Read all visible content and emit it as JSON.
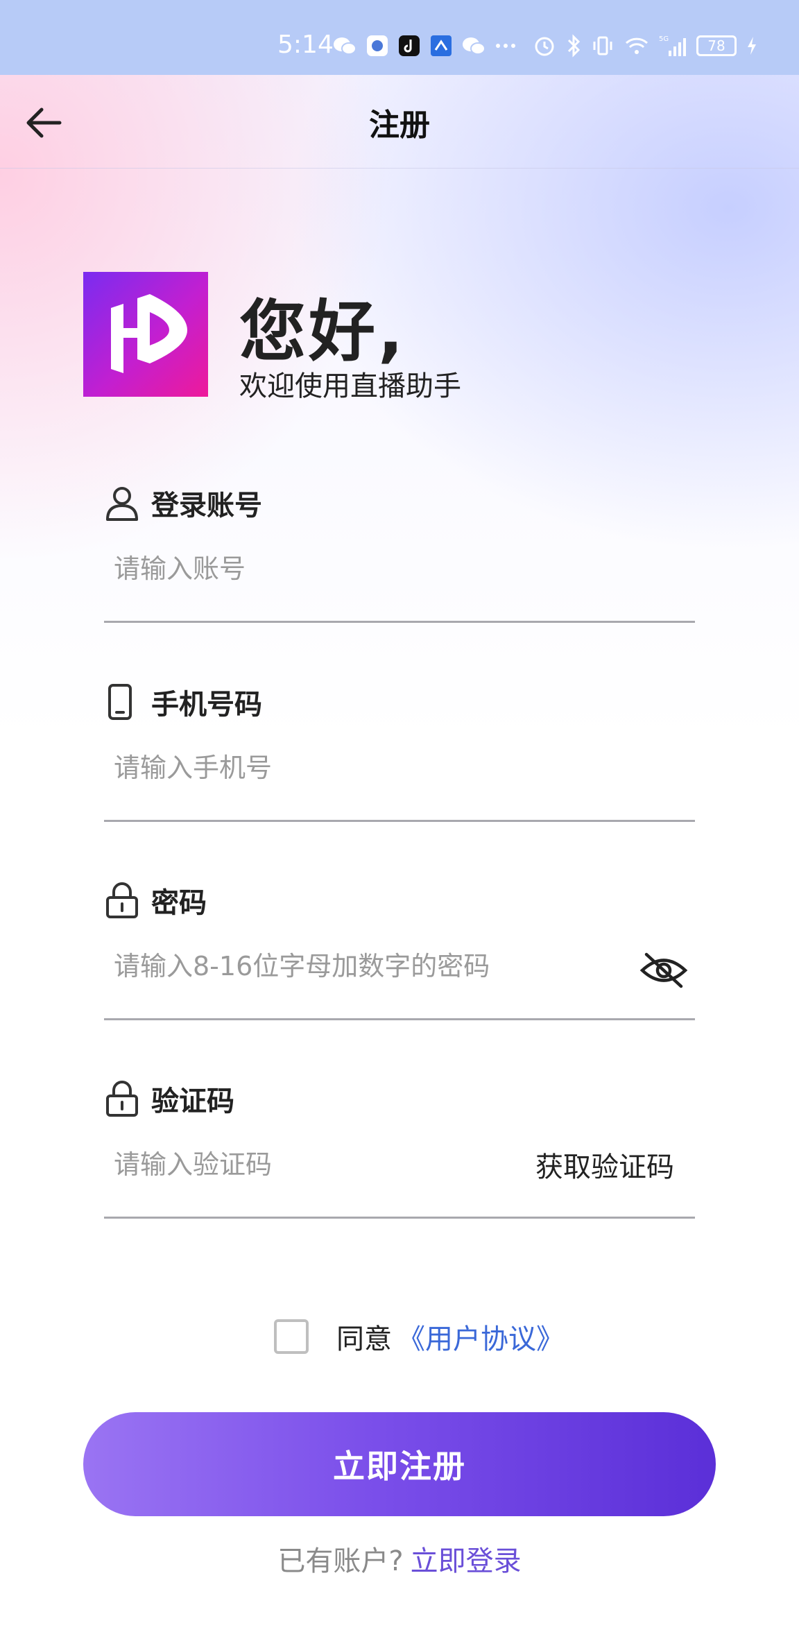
{
  "status_bar": {
    "time": "5:14",
    "battery": "78",
    "network": "5G"
  },
  "header": {
    "title": "注册"
  },
  "greeting": {
    "title": "您好,",
    "subtitle": "欢迎使用直播助手"
  },
  "form": {
    "account": {
      "label": "登录账号",
      "placeholder": "请输入账号"
    },
    "phone": {
      "label": "手机号码",
      "placeholder": "请输入手机号"
    },
    "password": {
      "label": "密码",
      "placeholder": "请输入8-16位字母加数字的密码"
    },
    "code": {
      "label": "验证码",
      "placeholder": "请输入验证码",
      "get_code_label": "获取验证码"
    }
  },
  "agreement": {
    "agree_text": "同意",
    "link_text": "《用户协议》"
  },
  "register_button": {
    "label": "立即注册"
  },
  "login": {
    "prompt": "已有账户?",
    "link": "立即登录"
  },
  "colors": {
    "accent": "#6a3fe0",
    "link_blue": "#3a68d8",
    "logo_start": "#7a2cf0",
    "logo_end": "#ee1a9a"
  },
  "icons": {
    "back": "arrow-left-icon",
    "account": "user-icon",
    "phone": "phone-icon",
    "password": "lock-icon",
    "code": "lock-icon",
    "eye": "eye-off-icon"
  }
}
